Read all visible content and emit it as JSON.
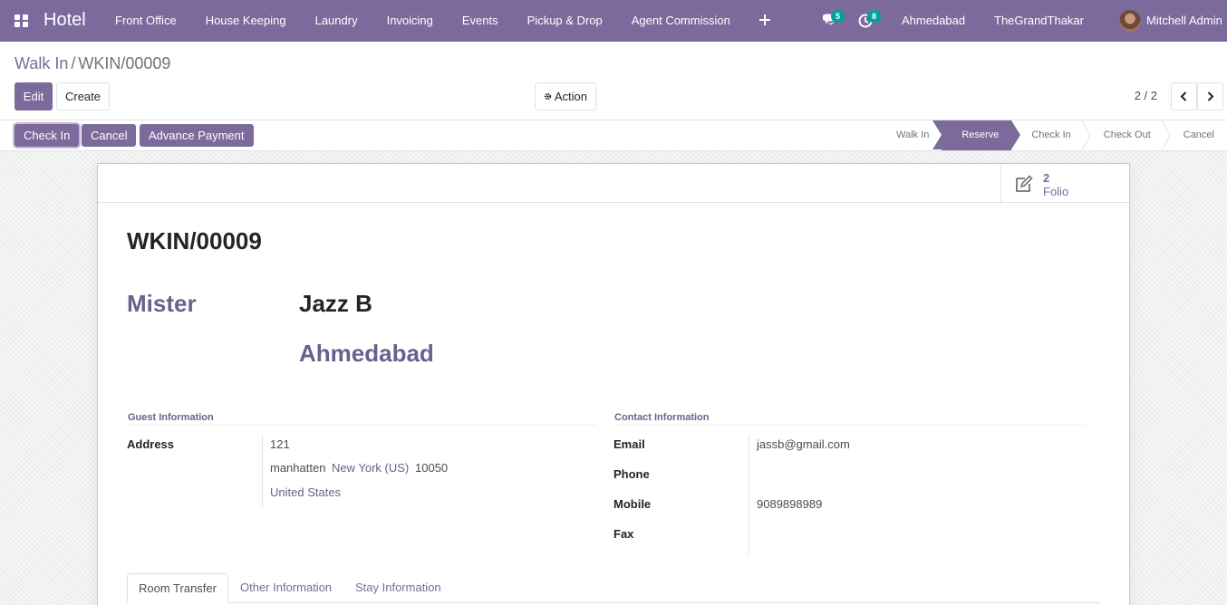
{
  "navbar": {
    "brand": "Hotel",
    "menu": [
      "Front Office",
      "House Keeping",
      "Laundry",
      "Invoicing",
      "Events",
      "Pickup & Drop",
      "Agent Commission"
    ],
    "messages_count": "5",
    "activities_count": "8",
    "branch": "Ahmedabad",
    "company": "TheGrandThakar",
    "user": "Mitchell Admin"
  },
  "breadcrumb": {
    "parent": "Walk In",
    "separator": "/",
    "current": "WKIN/00009"
  },
  "toolbar": {
    "edit": "Edit",
    "create": "Create",
    "action": "Action"
  },
  "pager": {
    "value": "2 / 2"
  },
  "status_buttons": {
    "check_in": "Check In",
    "cancel": "Cancel",
    "advance_payment": "Advance Payment"
  },
  "stages": [
    "Walk In",
    "Reserve",
    "Check In",
    "Check Out",
    "Cancel"
  ],
  "active_stage": "Reserve",
  "smart_button": {
    "value": "2",
    "label": "Folio"
  },
  "record": {
    "reference": "WKIN/00009",
    "title": "Mister",
    "name": "Jazz B",
    "city": "Ahmedabad"
  },
  "guest_information": {
    "heading": "Guest Information",
    "address_label": "Address",
    "street": "121",
    "city": "manhatten",
    "state": "New York (US)",
    "zip": "10050",
    "country": "United States"
  },
  "contact_information": {
    "heading": "Contact Information",
    "email_label": "Email",
    "email": "jassb@gmail.com",
    "phone_label": "Phone",
    "phone": "",
    "mobile_label": "Mobile",
    "mobile": "9089898989",
    "fax_label": "Fax",
    "fax": ""
  },
  "tabs": [
    "Room Transfer",
    "Other Information",
    "Stay Information"
  ],
  "colors": {
    "brand": "#7c6a9c",
    "badge": "#00a09d"
  }
}
